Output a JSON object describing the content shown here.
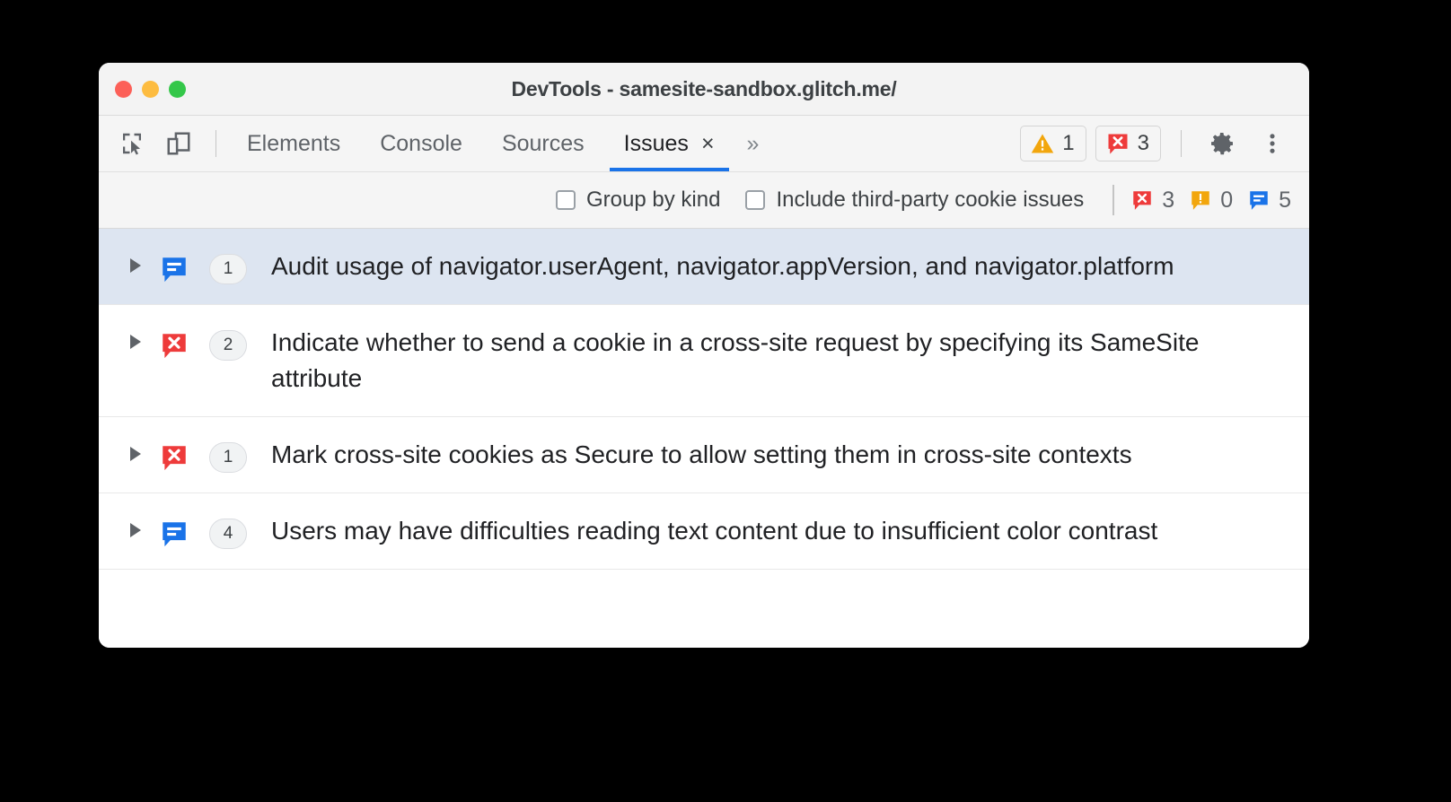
{
  "window": {
    "title": "DevTools - samesite-sandbox.glitch.me/",
    "traffic_lights": [
      "close-button",
      "minimize-button",
      "maximize-button"
    ]
  },
  "toolbar": {
    "inspect_icon": "inspect-element-icon",
    "device_icon": "device-toolbar-icon",
    "tabs": [
      {
        "label": "Elements",
        "active": false
      },
      {
        "label": "Console",
        "active": false
      },
      {
        "label": "Sources",
        "active": false
      },
      {
        "label": "Issues",
        "active": true,
        "close": "×"
      }
    ],
    "more_tabs": "»",
    "warning_count": "1",
    "error_count": "3",
    "settings_icon": "gear-icon",
    "menu_icon": "kebab-menu-icon"
  },
  "filterbar": {
    "group_by_kind": {
      "label": "Group by kind",
      "checked": false
    },
    "third_party": {
      "label": "Include third-party cookie issues",
      "checked": false
    },
    "counts": {
      "errors": "3",
      "warnings": "0",
      "info": "5"
    }
  },
  "issues": [
    {
      "kind": "info",
      "count": "1",
      "title": "Audit usage of navigator.userAgent, navigator.appVersion, and navigator.platform",
      "selected": true
    },
    {
      "kind": "error",
      "count": "2",
      "title": "Indicate whether to send a cookie in a cross-site request by specifying its SameSite attribute",
      "selected": false
    },
    {
      "kind": "error",
      "count": "1",
      "title": "Mark cross-site cookies as Secure to allow setting them in cross-site contexts",
      "selected": false
    },
    {
      "kind": "info",
      "count": "4",
      "title": "Users may have difficulties reading text content due to insufficient color contrast",
      "selected": false
    }
  ],
  "colors": {
    "error_red": "#ee3b3b",
    "warning_yellow": "#f2a60d",
    "info_blue": "#1a73e8",
    "accent_blue": "#1a73e8",
    "selected_row": "#dde5f1"
  }
}
